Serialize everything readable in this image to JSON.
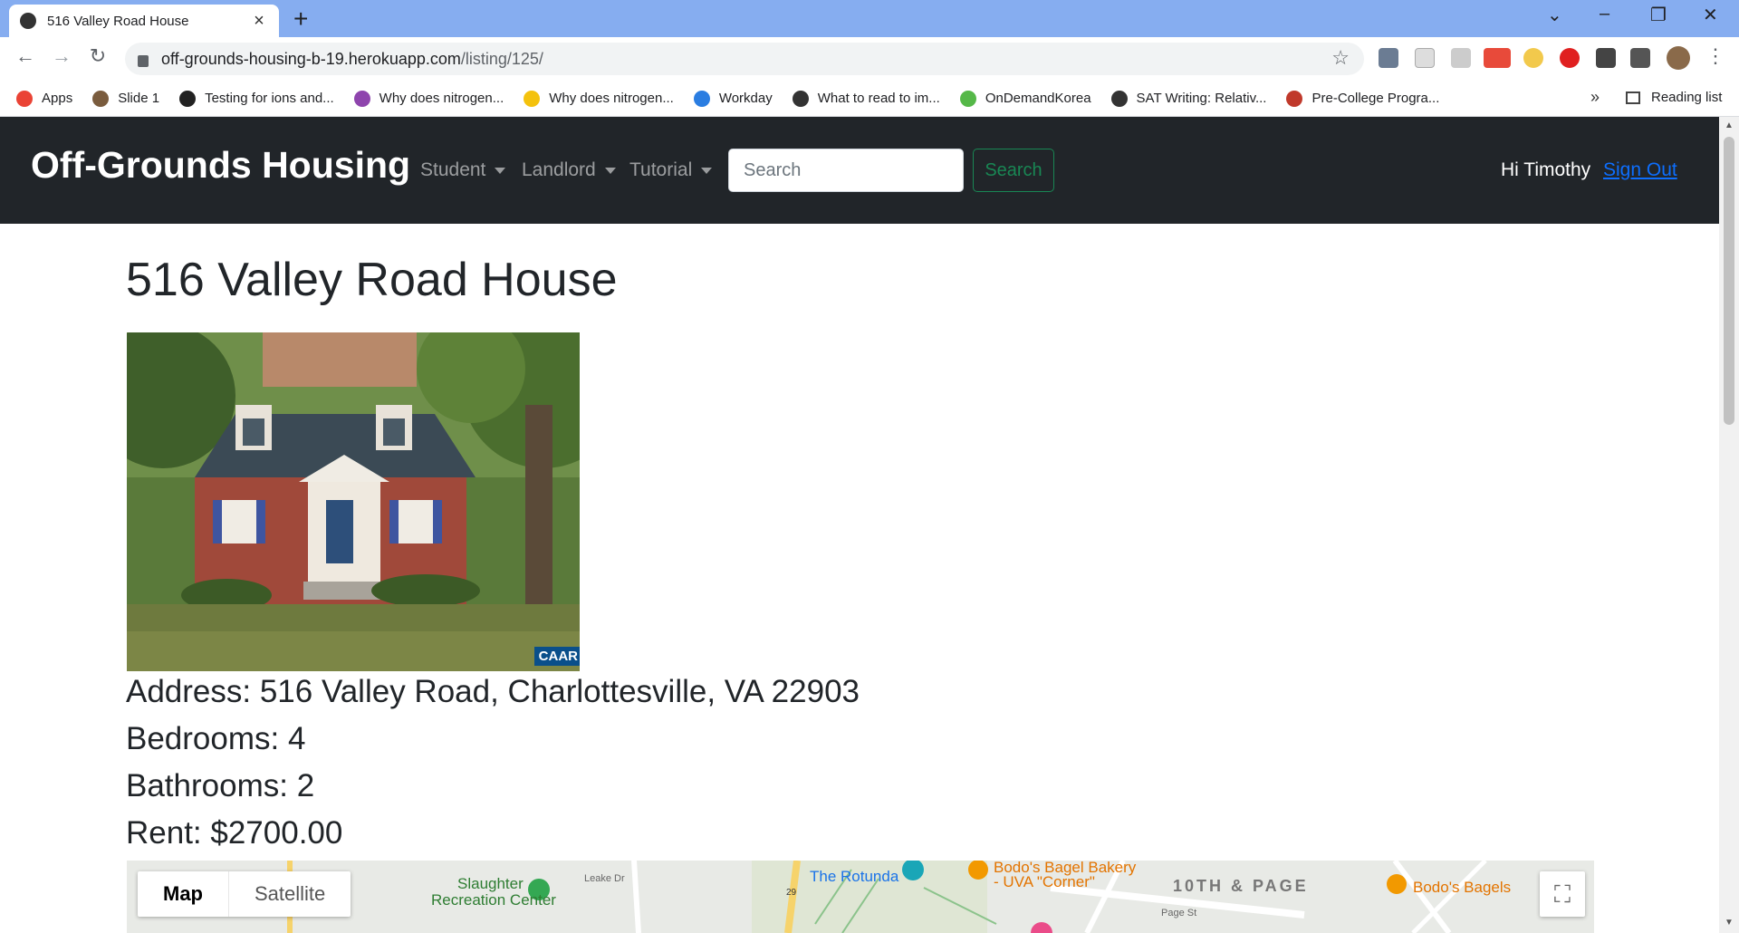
{
  "browser": {
    "tab_title": "516 Valley Road House",
    "url_host": "off-grounds-housing-b-19.herokuapp.com",
    "url_path": "/listing/125/",
    "bookmarks": [
      {
        "label": "Apps",
        "color": "#ea4335"
      },
      {
        "label": "Slide 1",
        "color": "#7a5c3e"
      },
      {
        "label": "Testing for ions and...",
        "color": "#222222"
      },
      {
        "label": "Why does nitrogen...",
        "color": "#8e44ad"
      },
      {
        "label": "Why does nitrogen...",
        "color": "#f4c20d"
      },
      {
        "label": "Workday",
        "color": "#2a7de1"
      },
      {
        "label": "What to read to im...",
        "color": "#333333"
      },
      {
        "label": "OnDemandKorea",
        "color": "#55b848"
      },
      {
        "label": "SAT Writing: Relativ...",
        "color": "#333333"
      },
      {
        "label": "Pre-College Progra...",
        "color": "#c0392b"
      }
    ],
    "more_bookmarks": "»",
    "reading_list": "Reading list"
  },
  "navbar": {
    "brand": "Off-Grounds Housing",
    "menus": [
      "Student",
      "Landlord",
      "Tutorial"
    ],
    "search_placeholder": "Search",
    "search_button": "Search",
    "greeting": "Hi Timothy",
    "sign_out": "Sign Out"
  },
  "listing": {
    "title": "516 Valley Road House",
    "photo_badge": "CAAR",
    "address": "Address: 516 Valley Road, Charlottesville, VA 22903",
    "bedrooms": "Bedrooms: 4",
    "bathrooms": "Bathrooms: 2",
    "rent": "Rent: $2700.00"
  },
  "map": {
    "type_map": "Map",
    "type_satellite": "Satellite",
    "labels": {
      "slaughter": "Slaughter",
      "rec_center": "Recreation Center",
      "rotunda": "The Rotunda",
      "bodos1": "Bodo's Bagel Bakery",
      "bodos1b": "- UVA \"Corner\"",
      "tenth_page": "10TH & PAGE",
      "bodos2": "Bodo's Bagels",
      "leake": "Leake Dr",
      "page_st": "Page St",
      "bus29": "29"
    }
  }
}
